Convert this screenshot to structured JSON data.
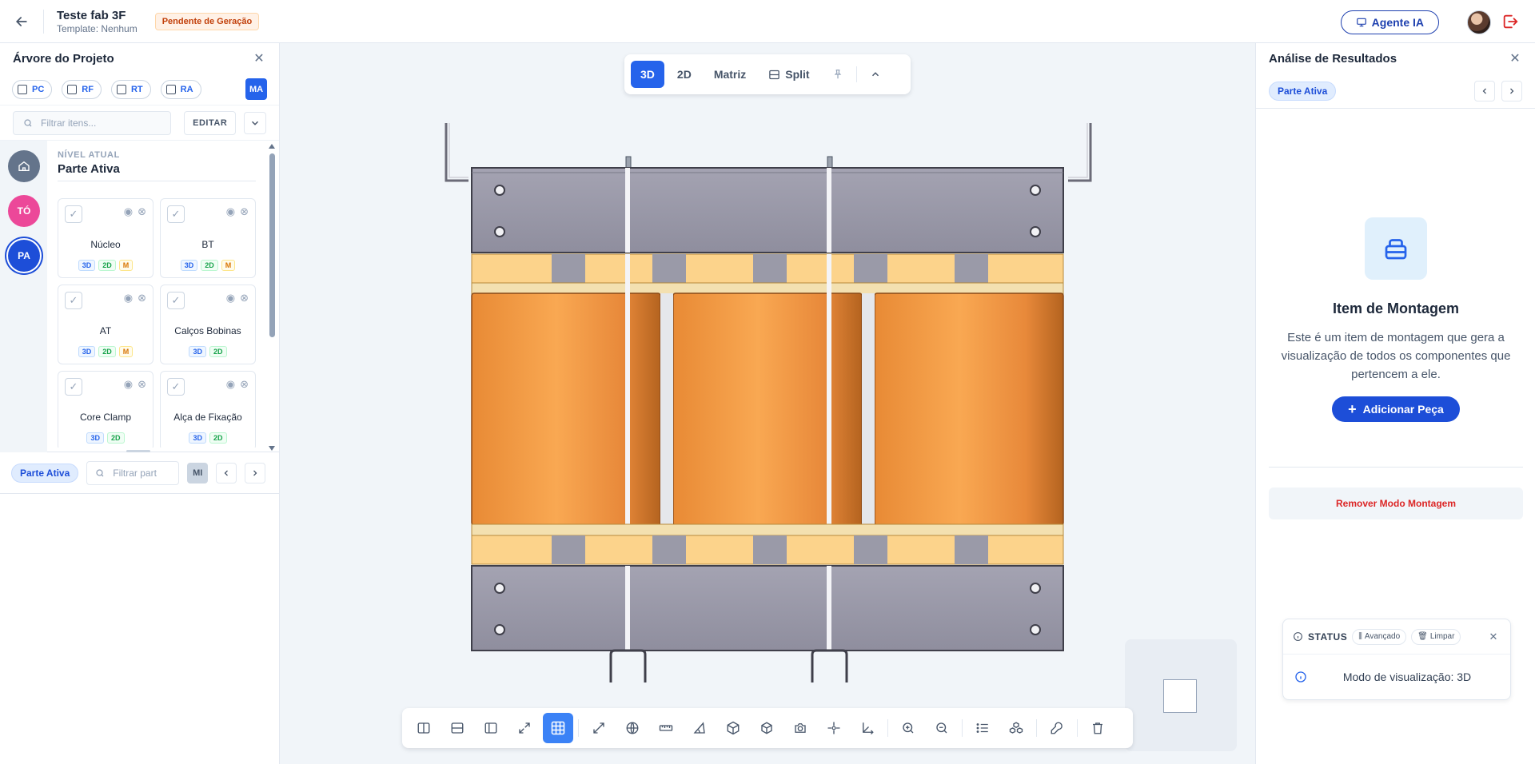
{
  "header": {
    "project_title": "Teste fab 3F",
    "template_label": "Template: Nenhum",
    "status_badge": "Pendente de Geração",
    "agent_button": "Agente IA"
  },
  "left_panel": {
    "title": "Árvore do Projeto",
    "filters": [
      "PC",
      "RF",
      "RT",
      "RA"
    ],
    "ma_button": "MA",
    "search_placeholder": "Filtrar itens...",
    "edit_button": "EDITAR",
    "rail": [
      "TÓ",
      "PA"
    ],
    "level_caption": "NÍVEL ATUAL",
    "level_name": "Parte Ativa",
    "cards": [
      {
        "name": "Núcleo",
        "tags": [
          "3D",
          "2D",
          "M"
        ]
      },
      {
        "name": "BT",
        "tags": [
          "3D",
          "2D",
          "M"
        ]
      },
      {
        "name": "AT",
        "tags": [
          "3D",
          "2D",
          "M"
        ]
      },
      {
        "name": "Calços Bobinas",
        "tags": [
          "3D",
          "2D"
        ]
      },
      {
        "name": "Core Clamp",
        "tags": [
          "3D",
          "2D"
        ]
      },
      {
        "name": "Alça de Fixação",
        "tags": [
          "3D",
          "2D"
        ]
      }
    ],
    "parts_pill": "Parte Ativa",
    "parts_search_placeholder": "Filtrar part",
    "mi_button": "MI"
  },
  "viewport": {
    "view_modes": [
      "3D",
      "2D",
      "Matriz",
      "Split"
    ],
    "active_view": "3D"
  },
  "right_panel": {
    "title": "Análise de Resultados",
    "pill": "Parte Ativa",
    "empty_title": "Item de Montagem",
    "empty_desc": "Este é um item de montagem que gera a visualização de todos os componentes que pertencem a ele.",
    "add_button": "Adicionar Peça",
    "remove_button": "Remover Modo Montagem",
    "status_title": "STATUS",
    "status_advanced": "Avançado",
    "status_clear": "Limpar",
    "status_message": "Modo de visualização: 3D"
  },
  "colors": {
    "primary": "#2563eb",
    "coil_orange": "#f4a04a",
    "yoke_gray": "#9a9aa8",
    "danger": "#dc2626"
  }
}
